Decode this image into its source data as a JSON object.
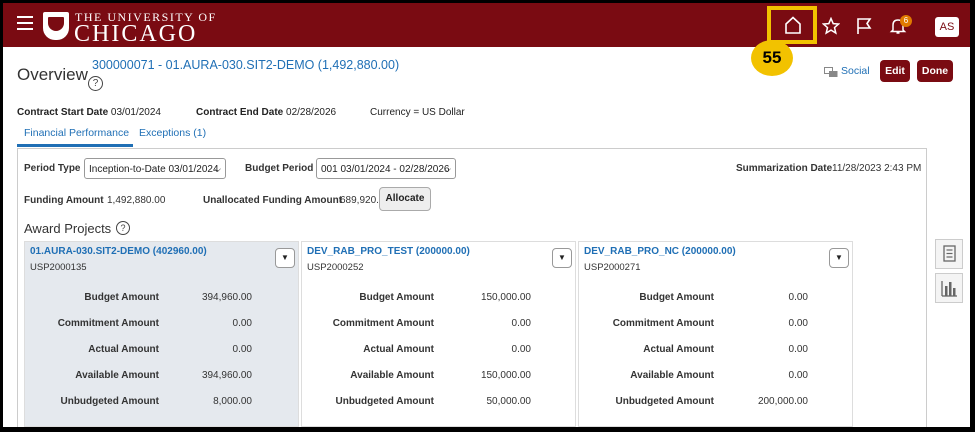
{
  "header": {
    "logo_line1": "THE UNIVERSITY OF",
    "logo_line2": "CHICAGO",
    "notification_count": "6",
    "avatar_initials": "AS",
    "step_number": "55"
  },
  "page": {
    "title": "Overview",
    "contract_link": "300000071 - 01.AURA-030.SIT2-DEMO (1,492,880.00)",
    "help_glyph": "?",
    "social_label": "Social",
    "edit_label": "Edit",
    "done_label": "Done"
  },
  "contract": {
    "start_label": "Contract Start Date",
    "start_value": "03/01/2024",
    "end_label": "Contract End Date",
    "end_value": "02/28/2026",
    "currency": "Currency = US Dollar"
  },
  "tabs": [
    {
      "label": "Financial Performance"
    },
    {
      "label": "Exceptions (1)"
    }
  ],
  "filters": {
    "period_type_label": "Period Type",
    "period_type_value": "Inception-to-Date 03/01/2024",
    "budget_period_label": "Budget Period",
    "budget_period_value": "001 03/01/2024 - 02/28/2026",
    "summarization_label": "Summarization Date",
    "summarization_value": "11/28/2023 2:43 PM",
    "funding_label": "Funding Amount",
    "funding_value": "1,492,880.00",
    "unallocated_label": "Unallocated Funding Amount",
    "unallocated_value": "689,920.00",
    "allocate_label": "Allocate"
  },
  "award_projects": {
    "title": "Award Projects",
    "row_labels": [
      "Budget Amount",
      "Commitment Amount",
      "Actual Amount",
      "Available Amount",
      "Unbudgeted Amount"
    ],
    "cards": [
      {
        "title": "01.AURA-030.SIT2-DEMO (402960.00)",
        "code": "USP2000135",
        "values": [
          "394,960.00",
          "0.00",
          "0.00",
          "394,960.00",
          "8,000.00"
        ]
      },
      {
        "title": "DEV_RAB_PRO_TEST (200000.00)",
        "code": "USP2000252",
        "values": [
          "150,000.00",
          "0.00",
          "0.00",
          "150,000.00",
          "50,000.00"
        ]
      },
      {
        "title": "DEV_RAB_PRO_NC (200000.00)",
        "code": "USP2000271",
        "values": [
          "0.00",
          "0.00",
          "0.00",
          "0.00",
          "200,000.00"
        ]
      }
    ]
  }
}
